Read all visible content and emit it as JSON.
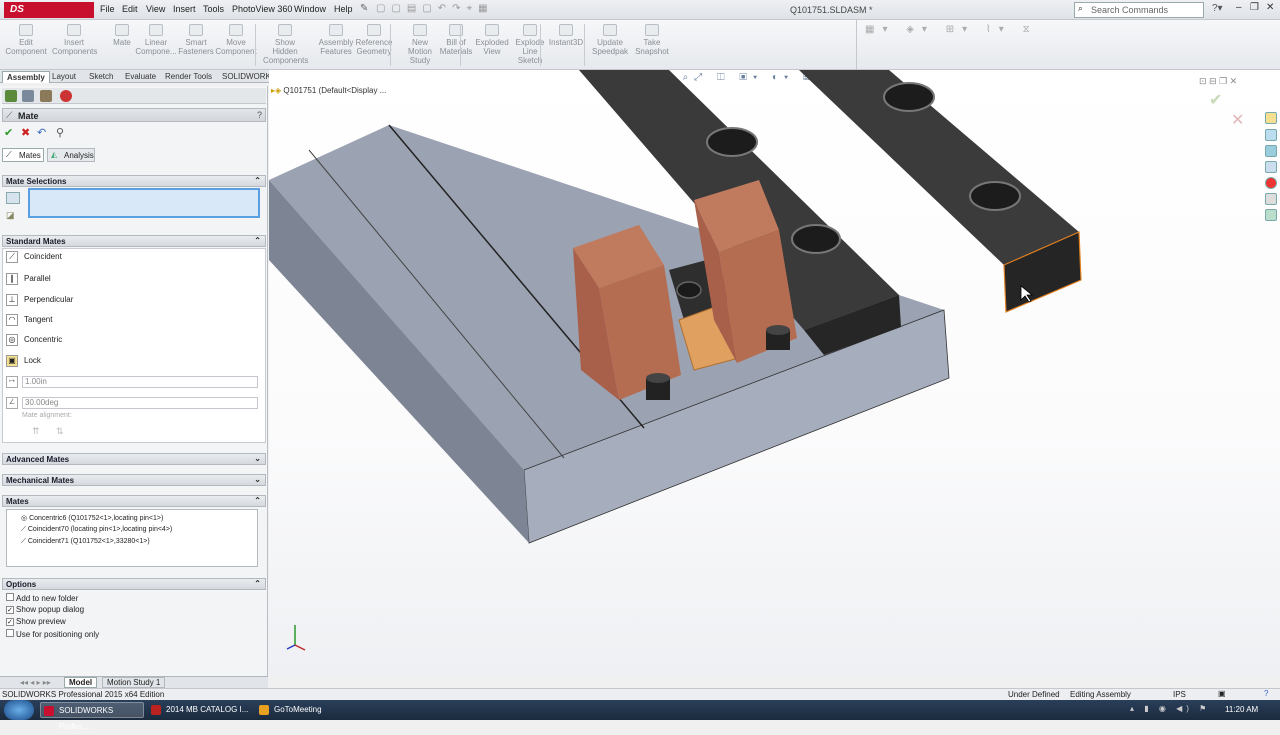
{
  "app": {
    "logo": "DS SOLIDWORKS",
    "doc_title": "Q101751.SLDASM *",
    "search_placeholder": "Search Commands"
  },
  "menu": [
    "File",
    "Edit",
    "View",
    "Insert",
    "Tools",
    "PhotoView 360",
    "Window",
    "Help"
  ],
  "command_manager": [
    {
      "label": "Edit\nComponent"
    },
    {
      "label": "Insert\nComponents"
    },
    {
      "label": "Mate"
    },
    {
      "label": "Linear\nCompone..."
    },
    {
      "label": "Smart\nFasteners"
    },
    {
      "label": "Move\nComponent"
    },
    {
      "label": "Show\nHidden\nComponents"
    },
    {
      "label": "Assembly\nFeatures"
    },
    {
      "label": "Reference\nGeometry"
    },
    {
      "label": "New\nMotion\nStudy"
    },
    {
      "label": "Bill of\nMaterials"
    },
    {
      "label": "Exploded\nView"
    },
    {
      "label": "Explode\nLine\nSketch"
    },
    {
      "label": "Instant3D"
    },
    {
      "label": "Update\nSpeedpak"
    },
    {
      "label": "Take\nSnapshot"
    }
  ],
  "tabs": [
    "Assembly",
    "Layout",
    "Sketch",
    "Evaluate",
    "Render Tools",
    "SOLIDWORKS Add-Ins"
  ],
  "panel": {
    "title": "Mate",
    "help": "?",
    "subtabs": [
      "Mates",
      "Analysis"
    ],
    "mate_selections": "Mate Selections",
    "standard_mates": "Standard Mates",
    "standard_items": [
      "Coincident",
      "Parallel",
      "Perpendicular",
      "Tangent",
      "Concentric",
      "Lock"
    ],
    "distance_value": "1.00in",
    "angle_value": "30.00deg",
    "mate_alignment": "Mate alignment:",
    "advanced_mates": "Advanced Mates",
    "mechanical_mates": "Mechanical Mates",
    "mates_header": "Mates",
    "mates_list": [
      "Concentric6 (Q101752<1>,locating pin<1>)",
      "Coincident70 (locating pin<1>,locating pin<4>)",
      "Coincident71 (Q101752<1>,33280<1>)"
    ],
    "options_header": "Options",
    "options": [
      {
        "label": "Add to new folder",
        "checked": false
      },
      {
        "label": "Show popup dialog",
        "checked": true
      },
      {
        "label": "Show preview",
        "checked": true
      },
      {
        "label": "Use for positioning only",
        "checked": false
      }
    ]
  },
  "tree_root": "Q101751  (Default<Display ...",
  "model_tabs": [
    "Model",
    "Motion Study 1"
  ],
  "status": {
    "edition": "SOLIDWORKS Professional 2015 x64 Edition",
    "state": "Under Defined",
    "mode": "Editing Assembly",
    "units": "IPS"
  },
  "taskbar": [
    {
      "label": "SOLIDWORKS Profes..."
    },
    {
      "label": "2014 MB CATALOG I..."
    },
    {
      "label": "GoToMeeting"
    }
  ],
  "clock": "11:20 AM",
  "colors": {
    "brand": "#c8102e",
    "copper": "#b0664a",
    "dark_part": "#2d2d2d",
    "base": "#9aa0b0"
  }
}
